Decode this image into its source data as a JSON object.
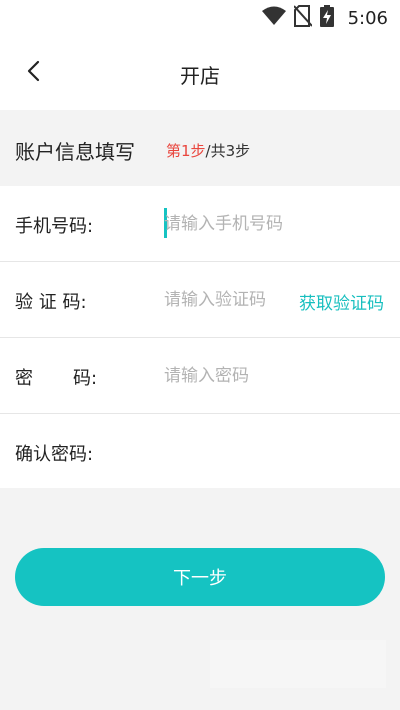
{
  "status_bar": {
    "time": "5:06",
    "icons": [
      "wifi-icon",
      "no-sim-icon",
      "battery-charging-icon"
    ]
  },
  "nav": {
    "title": "开店",
    "back_icon": "chevron-left-icon"
  },
  "section": {
    "title": "账户信息填写",
    "step_current": "第1步",
    "step_total": "/共3步"
  },
  "form": {
    "phone": {
      "label": "手机号码:",
      "placeholder": "请输入手机号码"
    },
    "code": {
      "label": "验 证 码:",
      "placeholder": "请输入验证码",
      "action": "获取验证码"
    },
    "password": {
      "label": "密       码:",
      "placeholder": "请输入密码"
    },
    "confirm": {
      "label": "确认密码:",
      "placeholder": ""
    }
  },
  "actions": {
    "next_label": "下一步"
  },
  "colors": {
    "accent": "#15c3c2",
    "step_highlight": "#e9463e",
    "placeholder": "#b3b3b3"
  }
}
